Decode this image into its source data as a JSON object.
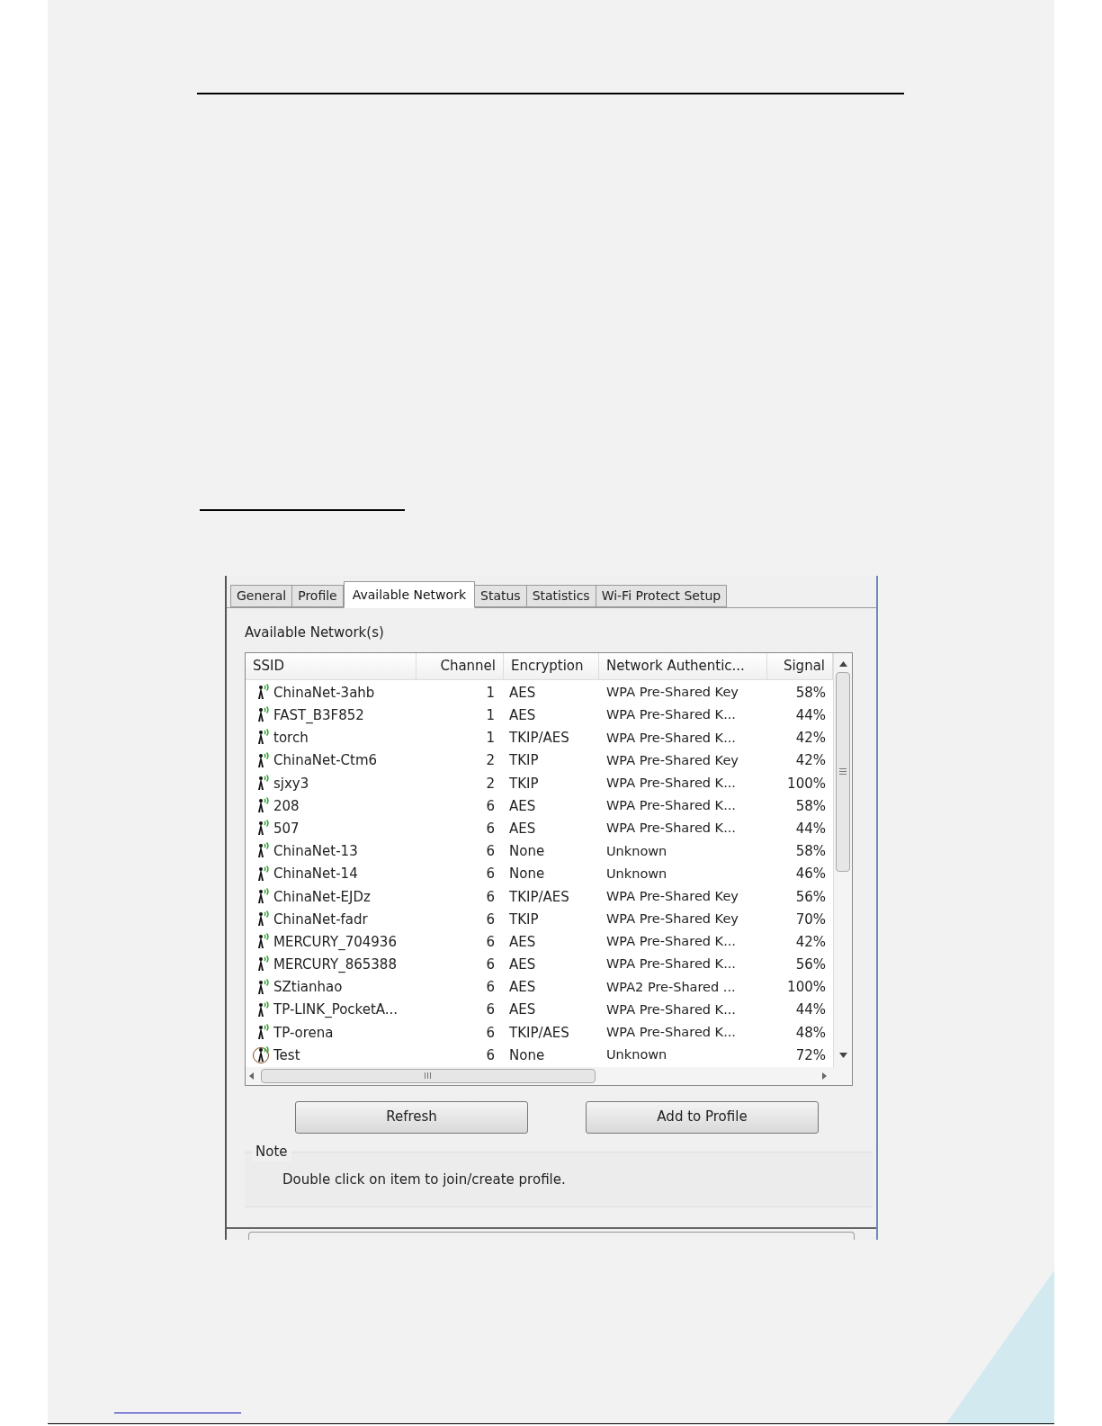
{
  "tabs": [
    {
      "label": "General",
      "selected": false
    },
    {
      "label": "Profile",
      "selected": false
    },
    {
      "label": "Available Network",
      "selected": true
    },
    {
      "label": "Status",
      "selected": false
    },
    {
      "label": "Statistics",
      "selected": false
    },
    {
      "label": "Wi-Fi Protect Setup",
      "selected": false
    }
  ],
  "section_title": "Available Network(s)",
  "table": {
    "columns": [
      "SSID",
      "Channel",
      "Encryption",
      "Network Authentic...",
      "Signal"
    ],
    "rows": [
      {
        "ssid": "ChinaNet-3ahb",
        "channel": "1",
        "encryption": "AES",
        "auth": "WPA Pre-Shared Key",
        "signal": "58%",
        "connected": false
      },
      {
        "ssid": "FAST_B3F852",
        "channel": "1",
        "encryption": "AES",
        "auth": "WPA Pre-Shared K...",
        "signal": "44%",
        "connected": false
      },
      {
        "ssid": "torch",
        "channel": "1",
        "encryption": "TKIP/AES",
        "auth": "WPA Pre-Shared K...",
        "signal": "42%",
        "connected": false
      },
      {
        "ssid": "ChinaNet-Ctm6",
        "channel": "2",
        "encryption": "TKIP",
        "auth": "WPA Pre-Shared Key",
        "signal": "42%",
        "connected": false
      },
      {
        "ssid": "sjxy3",
        "channel": "2",
        "encryption": "TKIP",
        "auth": "WPA Pre-Shared K...",
        "signal": "100%",
        "connected": false
      },
      {
        "ssid": "208",
        "channel": "6",
        "encryption": "AES",
        "auth": "WPA Pre-Shared K...",
        "signal": "58%",
        "connected": false
      },
      {
        "ssid": "507",
        "channel": "6",
        "encryption": "AES",
        "auth": "WPA Pre-Shared K...",
        "signal": "44%",
        "connected": false
      },
      {
        "ssid": "ChinaNet-13",
        "channel": "6",
        "encryption": "None",
        "auth": "Unknown",
        "signal": "58%",
        "connected": false
      },
      {
        "ssid": "ChinaNet-14",
        "channel": "6",
        "encryption": "None",
        "auth": "Unknown",
        "signal": "46%",
        "connected": false
      },
      {
        "ssid": "ChinaNet-EJDz",
        "channel": "6",
        "encryption": "TKIP/AES",
        "auth": "WPA Pre-Shared Key",
        "signal": "56%",
        "connected": false
      },
      {
        "ssid": "ChinaNet-fadr",
        "channel": "6",
        "encryption": "TKIP",
        "auth": "WPA Pre-Shared Key",
        "signal": "70%",
        "connected": false
      },
      {
        "ssid": "MERCURY_704936",
        "channel": "6",
        "encryption": "AES",
        "auth": "WPA Pre-Shared K...",
        "signal": "42%",
        "connected": false
      },
      {
        "ssid": "MERCURY_865388",
        "channel": "6",
        "encryption": "AES",
        "auth": "WPA Pre-Shared K...",
        "signal": "56%",
        "connected": false
      },
      {
        "ssid": "SZtianhao",
        "channel": "6",
        "encryption": "AES",
        "auth": "WPA2 Pre-Shared ...",
        "signal": "100%",
        "connected": false
      },
      {
        "ssid": "TP-LINK_PocketA...",
        "channel": "6",
        "encryption": "AES",
        "auth": "WPA Pre-Shared K...",
        "signal": "44%",
        "connected": false
      },
      {
        "ssid": "TP-orena",
        "channel": "6",
        "encryption": "TKIP/AES",
        "auth": "WPA Pre-Shared K...",
        "signal": "48%",
        "connected": false
      },
      {
        "ssid": "Test",
        "channel": "6",
        "encryption": "None",
        "auth": "Unknown",
        "signal": "72%",
        "connected": true
      }
    ]
  },
  "buttons": [
    "Refresh",
    "Add to Profile"
  ],
  "note": {
    "title": "Note",
    "text": "Double click on item to join/create profile."
  }
}
